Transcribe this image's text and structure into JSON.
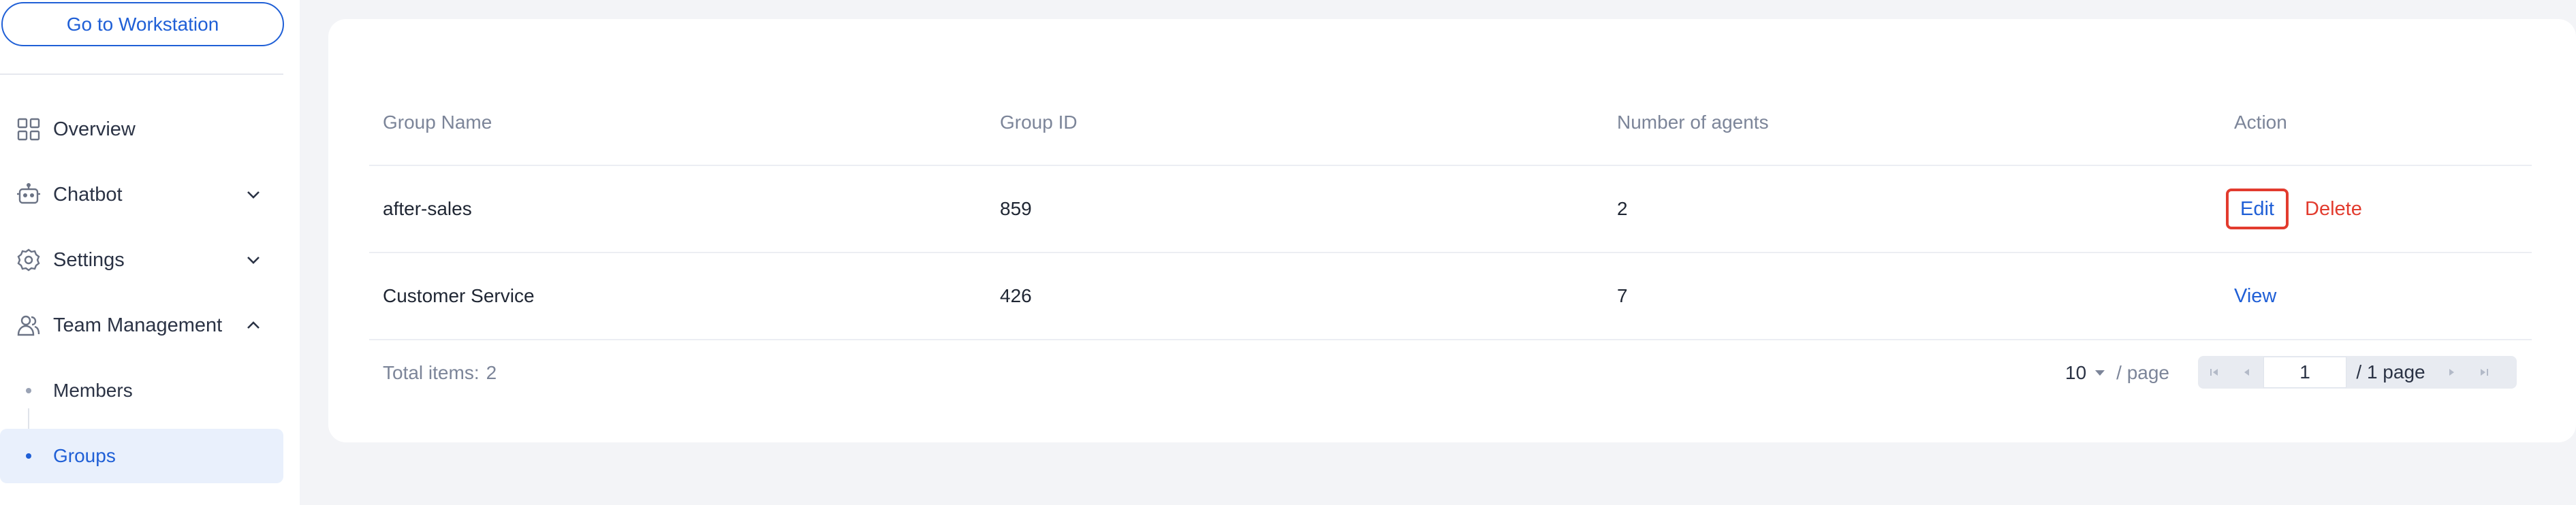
{
  "sidebar": {
    "workstation_button": "Go to Workstation",
    "nav": {
      "overview": "Overview",
      "chatbot": "Chatbot",
      "settings": "Settings",
      "team_management": "Team Management"
    },
    "sub_items": {
      "members": "Members",
      "groups": "Groups"
    },
    "active_item": "Groups",
    "accent_color": "#1f5fd6"
  },
  "table": {
    "columns": [
      "Group Name",
      "Group ID",
      "Number of agents",
      "Action"
    ],
    "rows": [
      {
        "name": "after-sales",
        "id": "859",
        "agents": "2",
        "actions": [
          "Edit",
          "Delete"
        ]
      },
      {
        "name": "Customer Service",
        "id": "426",
        "agents": "7",
        "actions": [
          "View"
        ]
      }
    ]
  },
  "footer": {
    "total_label": "Total items:",
    "total_count": "2",
    "page_size": "10",
    "per_page_label": "/ page",
    "current_page": "1",
    "total_pages_label": "/ 1 page"
  },
  "colors": {
    "link": "#1f5fd6",
    "danger": "#e23b2e",
    "background": "#f3f4f7"
  }
}
